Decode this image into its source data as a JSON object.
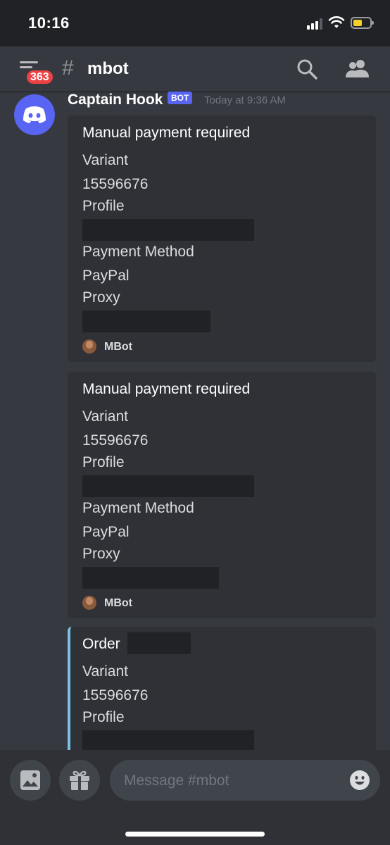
{
  "status_bar": {
    "time": "10:16"
  },
  "header": {
    "unread_badge": "363",
    "channel_name": "mbot"
  },
  "message": {
    "author": "Captain Hook",
    "bot_tag": "BOT",
    "timestamp": "Today at 9:36 AM",
    "embeds": [
      {
        "title": "Manual payment required",
        "fields": [
          {
            "name": "Variant",
            "value": "15596676"
          },
          {
            "name": "Profile",
            "value": ""
          },
          {
            "name": "Payment Method",
            "value": "PayPal"
          },
          {
            "name": "Proxy",
            "value": ""
          }
        ],
        "footer": "MBot"
      },
      {
        "title": "Manual payment required",
        "fields": [
          {
            "name": "Variant",
            "value": "15596676"
          },
          {
            "name": "Profile",
            "value": ""
          },
          {
            "name": "Payment Method",
            "value": "PayPal"
          },
          {
            "name": "Proxy",
            "value": ""
          }
        ],
        "footer": "MBot"
      },
      {
        "title": "Order",
        "fields": [
          {
            "name": "Variant",
            "value": "15596676"
          },
          {
            "name": "Profile",
            "value": ""
          }
        ]
      }
    ]
  },
  "composer": {
    "placeholder": "Message #mbot"
  },
  "colors": {
    "background": "#36393f",
    "embed_background": "#2f3136",
    "blurple": "#5865f2",
    "badge_red": "#ed4245",
    "order_accent": "#7cc0e6"
  }
}
